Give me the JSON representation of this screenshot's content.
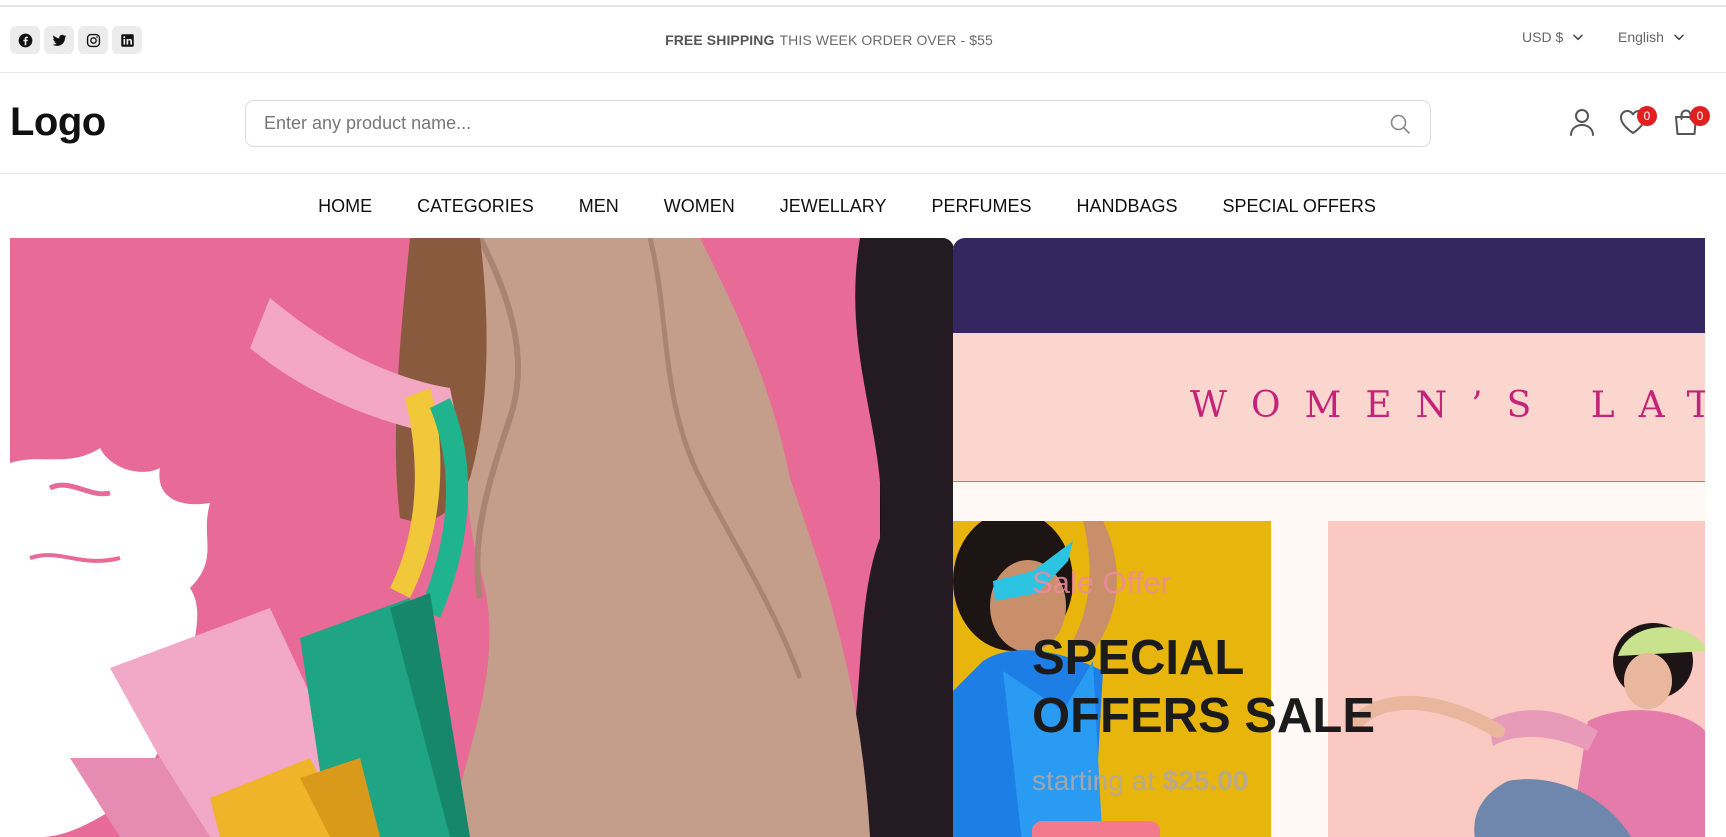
{
  "topbar": {
    "social": [
      "facebook-icon",
      "twitter-icon",
      "instagram-icon",
      "linkedin-icon"
    ],
    "promo_bold": "FREE SHIPPING",
    "promo_text": "THIS WEEK ORDER OVER - $55",
    "currency": "USD $",
    "language": "English"
  },
  "header": {
    "logo": "Logo",
    "search_placeholder": "Enter any product name...",
    "wishlist_count": "0",
    "cart_count": "0"
  },
  "nav": {
    "items": [
      "HOME",
      "CATEGORIES",
      "MEN",
      "WOMEN",
      "JEWELLARY",
      "PERFUMES",
      "HANDBAGS",
      "SPECIAL OFFERS"
    ]
  },
  "banner": {
    "collection_text": "WOMEN’S LAT",
    "eyebrow": "Sale Offer",
    "title": "SPECIAL OFFERS SALE",
    "price_prefix": "starting at",
    "price": "$25.00"
  },
  "colors": {
    "accent": "#e02020",
    "banner_dark": "#342760",
    "banner_pink": "#fbd6cf",
    "sale_pink": "#f28aa1"
  }
}
